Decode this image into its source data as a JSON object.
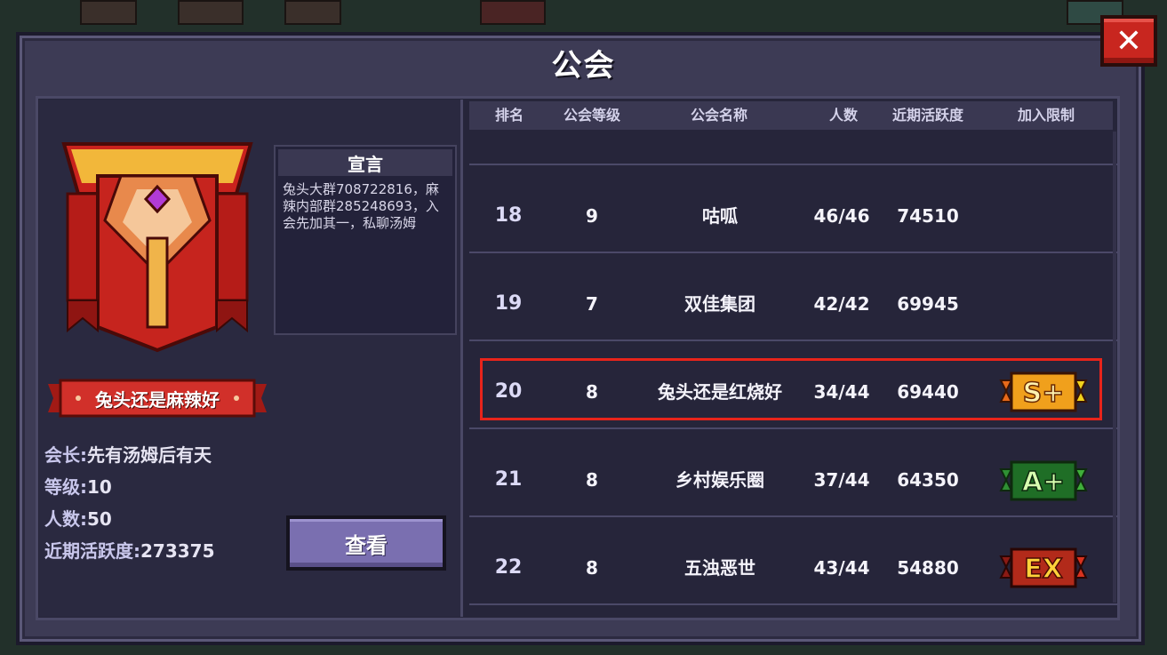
{
  "title": "公会",
  "close_label": "✕",
  "guild": {
    "banner_name": "兔头还是麻辣好",
    "declaration_title": "宣言",
    "declaration_text": "兔头大群708722816，麻辣内部群285248693，入会先加其一，私聊汤姆",
    "leader_label": "会长:",
    "leader_value": "先有汤姆后有天",
    "level_label": "等级:",
    "level_value": "10",
    "members_label": "人数:",
    "members_value": "50",
    "activity_label": "近期活跃度:",
    "activity_value": "273375",
    "view_button": "查看"
  },
  "table": {
    "headers": [
      "排名",
      "公会等级",
      "公会名称",
      "人数",
      "近期活跃度",
      "加入限制"
    ],
    "rows": [
      {
        "rank": "18",
        "level": "9",
        "name": "咕呱",
        "members": "46/46",
        "activity": "74510",
        "limit": ""
      },
      {
        "rank": "19",
        "level": "7",
        "name": "双佳集团",
        "members": "42/42",
        "activity": "69945",
        "limit": ""
      },
      {
        "rank": "20",
        "level": "8",
        "name": "兔头还是红烧好",
        "members": "34/44",
        "activity": "69440",
        "limit": "S+"
      },
      {
        "rank": "21",
        "level": "8",
        "name": "乡村娱乐圈",
        "members": "37/44",
        "activity": "64350",
        "limit": "A+"
      },
      {
        "rank": "22",
        "level": "8",
        "name": "五浊恶世",
        "members": "43/44",
        "activity": "54880",
        "limit": "EX"
      }
    ]
  },
  "colors": {
    "highlight": "#e8241b",
    "badge_s": "#f0a01c",
    "badge_a": "#3fae3a",
    "badge_ex": "#d8321e"
  }
}
